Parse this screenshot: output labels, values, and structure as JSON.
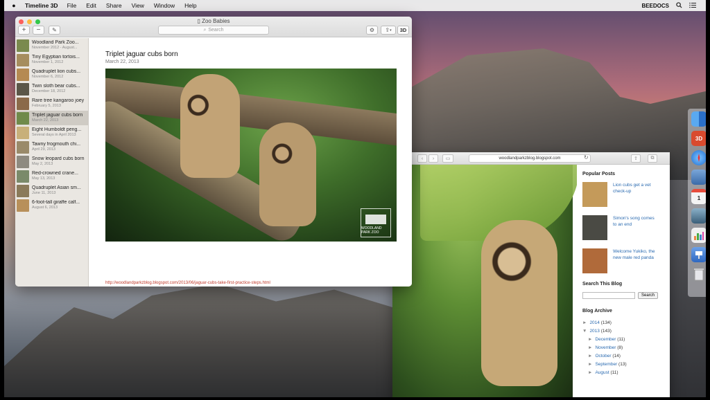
{
  "menubar": {
    "apple": "",
    "app_name": "Timeline 3D",
    "items": [
      "File",
      "Edit",
      "Share",
      "View",
      "Window",
      "Help"
    ],
    "user": "BEEDOCS",
    "search_icon": "search-icon",
    "list_icon": "list-icon"
  },
  "window": {
    "title": "Zoo Babies",
    "toolbar": {
      "add": "+",
      "remove": "−",
      "edit": "✎",
      "search_placeholder": "Search",
      "settings": "⚙",
      "share": "⇪",
      "view_3d": "3D"
    }
  },
  "sidebar": {
    "items": [
      {
        "title": "Woodland Park Zoo...",
        "date": "November 2012 - August...",
        "color": "#7a8a4e"
      },
      {
        "title": "Tiny Egyptian tortois...",
        "date": "November 1, 2012",
        "color": "#a68d5e"
      },
      {
        "title": "Quadruplet lion cubs...",
        "date": "November 6, 2012",
        "color": "#b58a52"
      },
      {
        "title": "Twin sloth bear cubs...",
        "date": "December 18, 2012",
        "color": "#5b5648"
      },
      {
        "title": "Rare tree kangaroo joey",
        "date": "February 5, 2013",
        "color": "#8b6a4a"
      },
      {
        "title": "Triplet jaguar cubs born",
        "date": "March 22, 2013",
        "color": "#6f8a4a"
      },
      {
        "title": "Eight Humboldt peng...",
        "date": "Several days in April 2013",
        "color": "#c8b07a"
      },
      {
        "title": "Tawny frogmouth chi...",
        "date": "April 29, 2013",
        "color": "#9a8a6a"
      },
      {
        "title": "Snow leopard cubs born",
        "date": "May 2, 2013",
        "color": "#8e8a80"
      },
      {
        "title": "Red-crowned crane...",
        "date": "May 13, 2013",
        "color": "#7a8a6a"
      },
      {
        "title": "Quadruplet Asian sm...",
        "date": "June 11, 2013",
        "color": "#8a7a5a"
      },
      {
        "title": "6-foot-tall giraffe calf...",
        "date": "August 6, 2013",
        "color": "#b8905a"
      }
    ],
    "selected_index": 5
  },
  "post": {
    "title": "Triplet jaguar cubs born",
    "date": "March 22, 2013",
    "link": "http://woodlandparkzblog.blogspot.com/2013/06/jaguar-cubs-take-first-practice-steps.html",
    "logo_text": "WOODLAND PARK ZOO"
  },
  "browser": {
    "url": "woodlandparkzblog.blogspot.com",
    "popular_heading": "Popular Posts",
    "popular": [
      {
        "text": "Lion cubs get a vet check-up",
        "color": "#c49a5a"
      },
      {
        "text": "Simon's song comes to an end",
        "color": "#4a4a44"
      },
      {
        "text": "Welcome Yukiko, the new male red panda",
        "color": "#b06a3a"
      }
    ],
    "search_heading": "Search This Blog",
    "search_button": "Search",
    "archive_heading": "Blog Archive",
    "archive": [
      {
        "caret": "►",
        "label": "2014",
        "count": "(134)",
        "indent": 0
      },
      {
        "caret": "▼",
        "label": "2013",
        "count": "(143)",
        "indent": 0
      },
      {
        "caret": "►",
        "label": "December",
        "count": "(11)",
        "indent": 1
      },
      {
        "caret": "►",
        "label": "November",
        "count": "(8)",
        "indent": 1
      },
      {
        "caret": "►",
        "label": "October",
        "count": "(14)",
        "indent": 1
      },
      {
        "caret": "►",
        "label": "September",
        "count": "(13)",
        "indent": 1
      },
      {
        "caret": "►",
        "label": "August",
        "count": "(11)",
        "indent": 1
      }
    ]
  },
  "dock": {
    "items": [
      {
        "name": "finder-icon",
        "color": "#3b82d6",
        "glyph": ""
      },
      {
        "name": "timeline-3d-icon",
        "color": "#d94a2e",
        "glyph": "3D"
      },
      {
        "name": "safari-icon",
        "color": "#2f7fd8",
        "glyph": ""
      },
      {
        "name": "preview-icon",
        "color": "#5a8ac0",
        "glyph": ""
      },
      {
        "name": "calendar-icon",
        "color": "#f4f4f4",
        "glyph": "1"
      },
      {
        "name": "photos-icon",
        "color": "#4a7a9a",
        "glyph": ""
      },
      {
        "name": "numbers-icon",
        "color": "#3a9a5a",
        "glyph": ""
      },
      {
        "name": "keynote-icon",
        "color": "#4a7ac8",
        "glyph": ""
      },
      {
        "name": "trash-icon",
        "color": "#c8c8cc",
        "glyph": ""
      }
    ]
  }
}
